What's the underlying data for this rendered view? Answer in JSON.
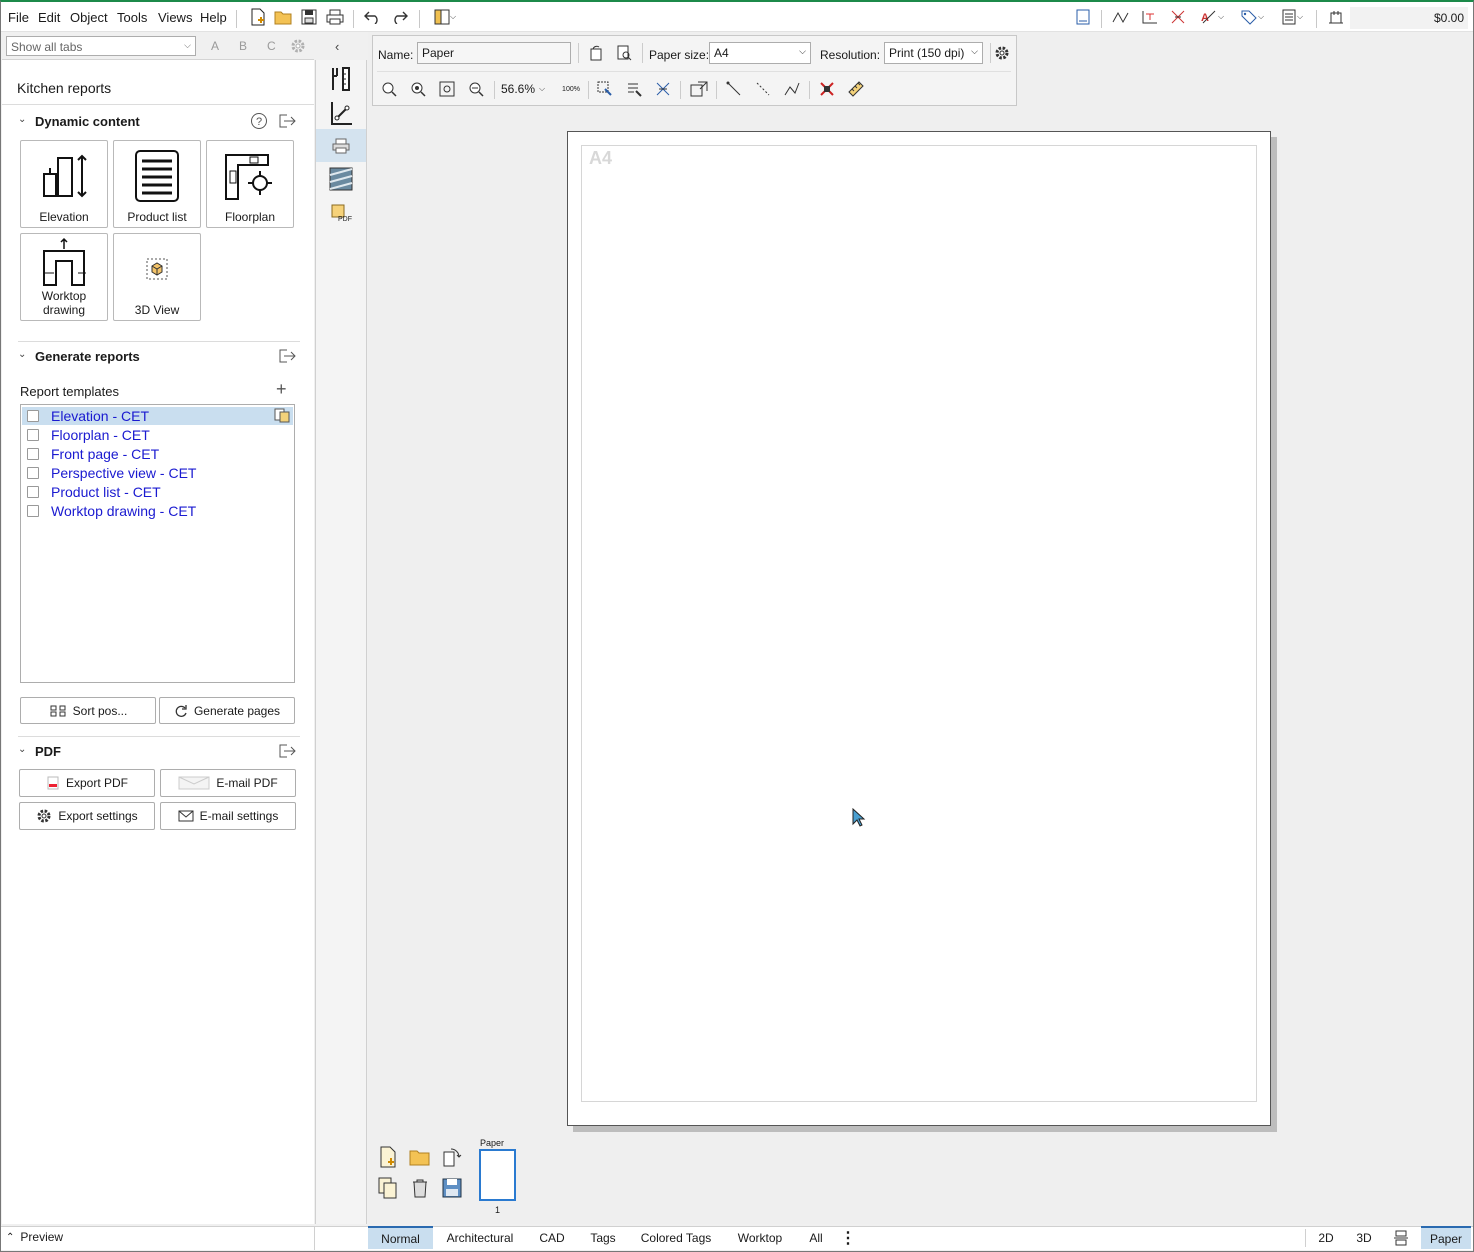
{
  "menu": {
    "file": "File",
    "edit": "Edit",
    "object": "Object",
    "tools": "Tools",
    "views": "Views",
    "help": "Help"
  },
  "price": "$0.00",
  "tabs_filter": {
    "value": "Show all tabs",
    "letters": [
      "A",
      "B",
      "C"
    ]
  },
  "panel": {
    "title": "Kitchen reports",
    "dynamic": {
      "header": "Dynamic content",
      "tiles": [
        {
          "label": "Elevation",
          "icon": "elevation-icon"
        },
        {
          "label": "Product list",
          "icon": "product-list-icon"
        },
        {
          "label": "Floorplan",
          "icon": "floorplan-icon"
        },
        {
          "label": "Worktop drawing",
          "icon": "worktop-drawing-icon"
        },
        {
          "label": "3D View",
          "icon": "cube-icon"
        }
      ]
    },
    "generate": {
      "header": "Generate reports",
      "templates_label": "Report templates",
      "templates": [
        "Elevation - CET",
        "Floorplan - CET",
        "Front page - CET",
        "Perspective view - CET",
        "Product list - CET",
        "Worktop drawing - CET"
      ],
      "sort_button": "Sort pos...",
      "generate_button": "Generate pages"
    },
    "pdf": {
      "header": "PDF",
      "export_pdf": "Export PDF",
      "email_pdf": "E-mail PDF",
      "export_settings": "Export settings",
      "email_settings": "E-mail settings"
    }
  },
  "toolbar": {
    "name_label": "Name:",
    "name_value": "Paper",
    "paper_size_label": "Paper size:",
    "paper_size_value": "A4",
    "resolution_label": "Resolution:",
    "resolution_value": "Print (150 dpi)",
    "zoom": "56.6%",
    "zoom_100": "100%"
  },
  "canvas": {
    "paper_label": "A4"
  },
  "thumbs": {
    "label": "Paper",
    "page": "1"
  },
  "statusbar": {
    "preview": "Preview",
    "layers": [
      "Normal",
      "Architectural",
      "CAD",
      "Tags",
      "Colored Tags",
      "Worktop",
      "All"
    ],
    "views": [
      "2D",
      "3D",
      "Paper"
    ]
  },
  "colors": {
    "accent": "#1c8a4a",
    "selected": "#c9deef",
    "link": "#1a1ad0"
  }
}
